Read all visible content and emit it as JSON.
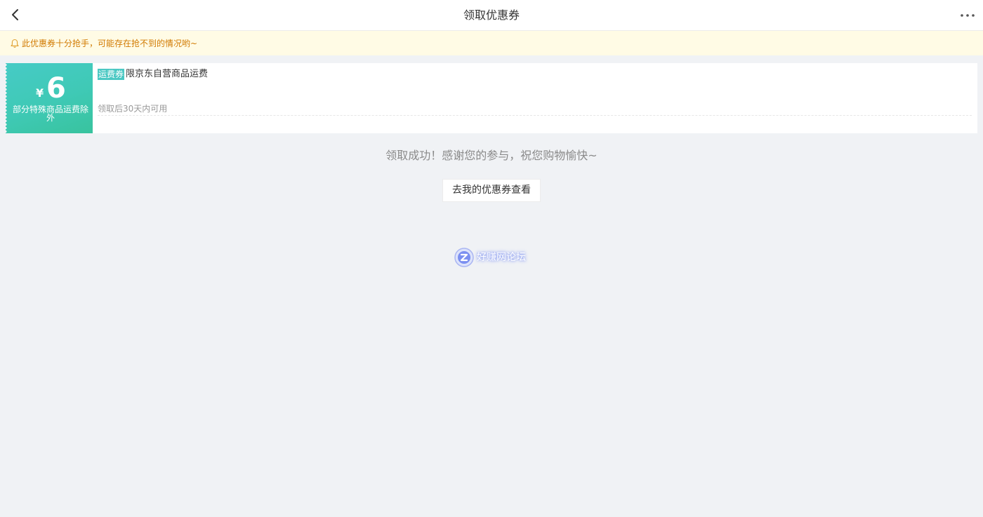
{
  "header": {
    "title": "领取优惠券",
    "back_icon": "chevron-left-icon",
    "more_icon": "more-dots-icon"
  },
  "notice": {
    "icon": "bell-icon",
    "text": "此优惠券十分抢手，可能存在抢不到的情况哟~",
    "color": "#d17a00",
    "background": "#fffbe5"
  },
  "coupon": {
    "currency": "¥",
    "amount": "6",
    "limit_text": "部分特殊商品运费除外",
    "tag": "运费券",
    "scope": "限京东自营商品运费",
    "validity": "领取后30天内可用",
    "accent": "#46cbc6"
  },
  "result": {
    "message": "领取成功！感谢您的参与，祝您购物愉快~",
    "button_label": "去我的优惠券查看"
  },
  "watermark": {
    "text": "好赚网论坛",
    "logo_letter": "Z"
  }
}
